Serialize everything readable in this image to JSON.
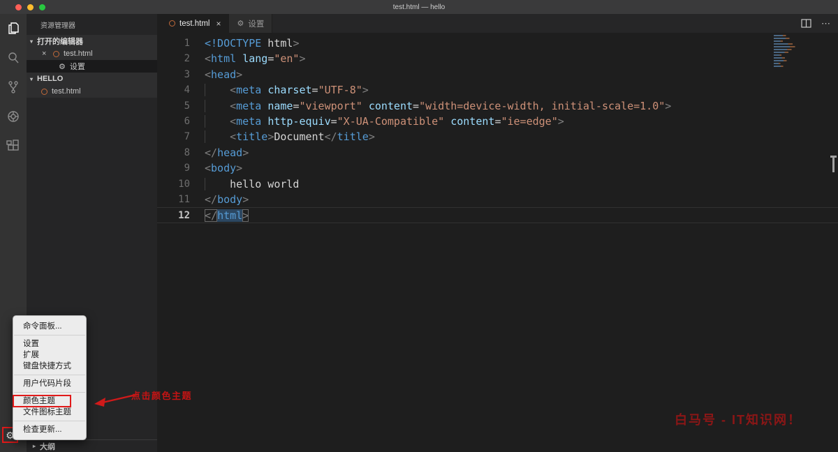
{
  "window": {
    "title": "test.html — hello"
  },
  "activity_bar": {
    "items": [
      {
        "name": "explorer",
        "active": true
      },
      {
        "name": "search",
        "active": false
      },
      {
        "name": "source-control",
        "active": false
      },
      {
        "name": "debug",
        "active": false
      },
      {
        "name": "extensions",
        "active": false
      }
    ],
    "manage_label": "manage-gear"
  },
  "icons": {
    "close": "×",
    "gear": "⚙",
    "chevron_down": "▾",
    "chevron_right": "▸",
    "more": "⋯"
  },
  "sidebar": {
    "header": "资源管理器",
    "open_editors": {
      "label": "打开的编辑器",
      "items": [
        {
          "name": "test.html"
        },
        {
          "name": "设置"
        }
      ]
    },
    "folder": {
      "name": "HELLO",
      "files": [
        "test.html"
      ]
    },
    "outline_label": "大纲"
  },
  "tabs": [
    {
      "label": "test.html",
      "active": true
    },
    {
      "label": "设置",
      "active": false
    }
  ],
  "editor": {
    "colors": {
      "tag": "#569cd6",
      "attr": "#9cdcfe",
      "str": "#ce9178",
      "txt": "#d4d4d4",
      "pun": "#808080"
    },
    "lines": [
      {
        "num": 1,
        "segments": [
          [
            "<!DOCTYPE",
            "tag"
          ],
          [
            " html",
            "txt"
          ],
          [
            ">",
            "pun"
          ]
        ]
      },
      {
        "num": 2,
        "segments": [
          [
            "<",
            "pun"
          ],
          [
            "html",
            "tag"
          ],
          [
            " ",
            "txt"
          ],
          [
            "lang",
            "attr"
          ],
          [
            "=",
            "txt"
          ],
          [
            "\"en\"",
            "str"
          ],
          [
            ">",
            "pun"
          ]
        ]
      },
      {
        "num": 3,
        "segments": [
          [
            "<",
            "pun"
          ],
          [
            "head",
            "tag"
          ],
          [
            ">",
            "pun"
          ]
        ]
      },
      {
        "num": 4,
        "segments": [
          [
            "    ",
            "ind"
          ],
          [
            "<",
            "pun"
          ],
          [
            "meta",
            "tag"
          ],
          [
            " ",
            "txt"
          ],
          [
            "charset",
            "attr"
          ],
          [
            "=",
            "txt"
          ],
          [
            "\"UTF-8\"",
            "str"
          ],
          [
            ">",
            "pun"
          ]
        ]
      },
      {
        "num": 5,
        "segments": [
          [
            "    ",
            "ind"
          ],
          [
            "<",
            "pun"
          ],
          [
            "meta",
            "tag"
          ],
          [
            " ",
            "txt"
          ],
          [
            "name",
            "attr"
          ],
          [
            "=",
            "txt"
          ],
          [
            "\"viewport\"",
            "str"
          ],
          [
            " ",
            "txt"
          ],
          [
            "content",
            "attr"
          ],
          [
            "=",
            "txt"
          ],
          [
            "\"width=device-width, initial-scale=1.0\"",
            "str"
          ],
          [
            ">",
            "pun"
          ]
        ]
      },
      {
        "num": 6,
        "segments": [
          [
            "    ",
            "ind"
          ],
          [
            "<",
            "pun"
          ],
          [
            "meta",
            "tag"
          ],
          [
            " ",
            "txt"
          ],
          [
            "http-equiv",
            "attr"
          ],
          [
            "=",
            "txt"
          ],
          [
            "\"X-UA-Compatible\"",
            "str"
          ],
          [
            " ",
            "txt"
          ],
          [
            "content",
            "attr"
          ],
          [
            "=",
            "txt"
          ],
          [
            "\"ie=edge\"",
            "str"
          ],
          [
            ">",
            "pun"
          ]
        ]
      },
      {
        "num": 7,
        "segments": [
          [
            "    ",
            "ind"
          ],
          [
            "<",
            "pun"
          ],
          [
            "title",
            "tag"
          ],
          [
            ">",
            "pun"
          ],
          [
            "Document",
            "txt"
          ],
          [
            "</",
            "pun"
          ],
          [
            "title",
            "tag"
          ],
          [
            ">",
            "pun"
          ]
        ]
      },
      {
        "num": 8,
        "segments": [
          [
            "</",
            "pun"
          ],
          [
            "head",
            "tag"
          ],
          [
            ">",
            "pun"
          ]
        ]
      },
      {
        "num": 9,
        "segments": [
          [
            "<",
            "pun"
          ],
          [
            "body",
            "tag"
          ],
          [
            ">",
            "pun"
          ]
        ]
      },
      {
        "num": 10,
        "segments": [
          [
            "    ",
            "ind"
          ],
          [
            "hello world",
            "txt"
          ]
        ]
      },
      {
        "num": 11,
        "segments": [
          [
            "</",
            "pun"
          ],
          [
            "body",
            "tag"
          ],
          [
            ">",
            "pun"
          ]
        ]
      },
      {
        "num": 12,
        "active": true,
        "segments": [
          [
            "</",
            "pun",
            "box"
          ],
          [
            "html",
            "tag",
            "hl"
          ],
          [
            ">",
            "pun",
            "box"
          ]
        ]
      }
    ]
  },
  "menu": {
    "items": [
      {
        "label": "命令面板...",
        "divider_after": true
      },
      {
        "label": "设置"
      },
      {
        "label": "扩展"
      },
      {
        "label": "键盘快捷方式",
        "divider_after": true
      },
      {
        "label": "用户代码片段",
        "divider_after": true
      },
      {
        "label": "颜色主题",
        "highlighted": true
      },
      {
        "label": "文件图标主题",
        "divider_after": true
      },
      {
        "label": "检查更新..."
      }
    ]
  },
  "annotation": {
    "text": "点击颜色主题",
    "arrow_color": "#d01a1a"
  },
  "watermark": {
    "text": "白马号 - IT知识网！",
    "color": "#8c1616"
  }
}
